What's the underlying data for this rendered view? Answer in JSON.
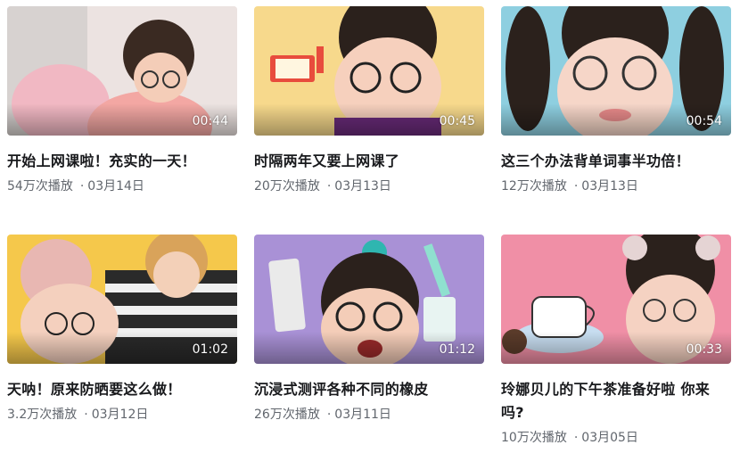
{
  "videos": [
    {
      "title": "开始上网课啦！充实的一天！",
      "views": "54万次播放",
      "date": "03月14日",
      "duration": "00:44",
      "color": "#e8c8c4"
    },
    {
      "title": "时隔两年又要上网课了",
      "views": "20万次播放",
      "date": "03月13日",
      "duration": "00:45",
      "color": "#f7d98c"
    },
    {
      "title": "这三个办法背单词事半功倍！",
      "views": "12万次播放",
      "date": "03月13日",
      "duration": "00:54",
      "color": "#8ecfe0"
    },
    {
      "title": "天呐！原来防晒要这么做！",
      "views": "3.2万次播放",
      "date": "03月12日",
      "duration": "01:02",
      "color": "#f5c84b"
    },
    {
      "title": "沉浸式测评各种不同的橡皮",
      "views": "26万次播放",
      "date": "03月11日",
      "duration": "01:12",
      "color": "#a991d6"
    },
    {
      "title": "玲娜贝儿的下午茶准备好啦 你来吗?",
      "views": "10万次播放",
      "date": "03月05日",
      "duration": "00:33",
      "color": "#f08fa6"
    }
  ]
}
